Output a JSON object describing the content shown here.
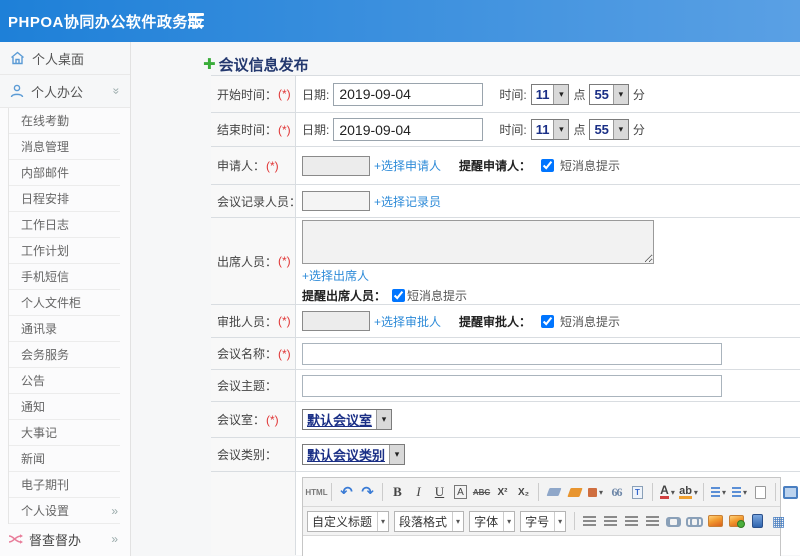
{
  "colors": {
    "topbar_blue": "#2a85d8",
    "link_blue": "#2e8bd8",
    "title_navy": "#23386e",
    "plus_green": "#3aad3a",
    "required_red": "#e03636"
  },
  "topbar": {
    "brand": "PHPOA协同办公软件政务版"
  },
  "sidebar": {
    "desktop": {
      "label": "个人桌面"
    },
    "office": {
      "label": "个人办公"
    },
    "sub_items": [
      "在线考勤",
      "消息管理",
      "内部邮件",
      "日程安排",
      "工作日志",
      "工作计划",
      "手机短信",
      "个人文件柜",
      "通讯录",
      "会务服务",
      "公告",
      "通知",
      "大事记",
      "新闻",
      "电子期刊"
    ],
    "settings": {
      "label": "个人设置",
      "chevron": "»"
    },
    "supervise": {
      "label": "督查督办",
      "chevron": "»"
    }
  },
  "page": {
    "title": "会议信息发布",
    "plus": "✚"
  },
  "form": {
    "start": {
      "label": "开始时间：",
      "req": "(*)",
      "date_label": "日期:",
      "date": "2019-09-04",
      "time_label": "时间:",
      "hour": "11",
      "hour_unit": "点",
      "minute": "55",
      "minute_unit": "分"
    },
    "end": {
      "label": "结束时间：",
      "req": "(*)",
      "date_label": "日期:",
      "date": "2019-09-04",
      "time_label": "时间:",
      "hour": "11",
      "hour_unit": "点",
      "minute": "55",
      "minute_unit": "分"
    },
    "applicant": {
      "label": "申请人：",
      "req": "(*)",
      "link": "+选择申请人",
      "remind": "提醒申请人：",
      "sms": "短消息提示",
      "checked": "checked"
    },
    "recorder": {
      "label": "会议记录人员：",
      "req": "(*)",
      "link": "+选择记录员"
    },
    "attendees": {
      "label": "出席人员：",
      "req": "(*)",
      "link": "+选择出席人",
      "remind": "提醒出席人员：",
      "sms": "短消息提示",
      "checked": "checked"
    },
    "approver": {
      "label": "审批人员：",
      "req": "(*)",
      "link": "+选择审批人",
      "remind": "提醒审批人：",
      "sms": "短消息提示",
      "checked": "checked"
    },
    "name": {
      "label": "会议名称：",
      "req": "(*)"
    },
    "subject": {
      "label": "会议主题："
    },
    "room": {
      "label": "会议室：",
      "req": "(*)",
      "value": "默认会议室"
    },
    "category": {
      "label": "会议类别：",
      "value": "默认会议类别"
    }
  },
  "editor": {
    "t1": {
      "html": "HTML",
      "undo": "↶",
      "redo": "↷",
      "bold": "B",
      "italic": "I",
      "underline": "U",
      "frame": "A",
      "strike": "ABC",
      "sup": "X²",
      "sub": "X₂",
      "quote": "66",
      "paste": "T",
      "fontcolor": "A",
      "highlight": "ab"
    },
    "t2": {
      "heading": "自定义标题",
      "paragraph": "段落格式",
      "font": "字体",
      "size": "字号"
    }
  }
}
